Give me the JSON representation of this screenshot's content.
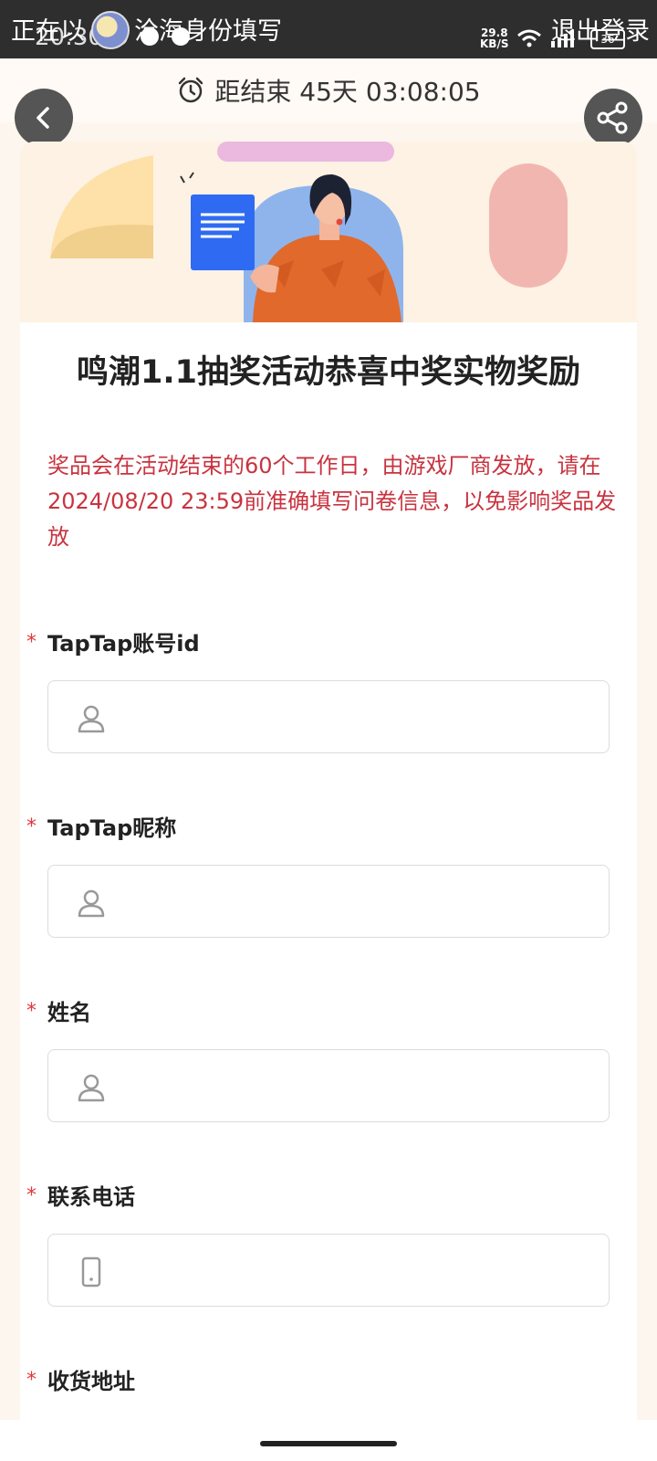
{
  "status_bar": {
    "login_prefix": "正在以",
    "identity_label": "沧海身份填写",
    "time": "20:30",
    "net_speed_value": "29.8",
    "net_speed_unit": "KB/S",
    "battery": "36",
    "logout": "退出登录"
  },
  "timer": {
    "text": "距结束 45天 03:08:05"
  },
  "form": {
    "title": "鸣潮1.1抽奖活动恭喜中奖实物奖励",
    "notice": "奖品会在活动结束的60个工作日，由游戏厂商发放，请在2024/08/20 23:59前准确填写问卷信息，以免影响奖品发放",
    "required_mark": "*",
    "fields": [
      {
        "label": "TapTap账号id",
        "value": "",
        "icon": "user-icon"
      },
      {
        "label": "TapTap昵称",
        "value": "",
        "icon": "user-icon"
      },
      {
        "label": "姓名",
        "value": "",
        "icon": "user-icon"
      },
      {
        "label": "联系电话",
        "value": "",
        "icon": "phone-icon"
      },
      {
        "label": "收货地址"
      }
    ]
  },
  "colors": {
    "accent_red": "#c8333f",
    "required_star": "#e0393e",
    "status_bar_bg": "#2e2e2e",
    "page_bg": "#fdf6ee"
  }
}
